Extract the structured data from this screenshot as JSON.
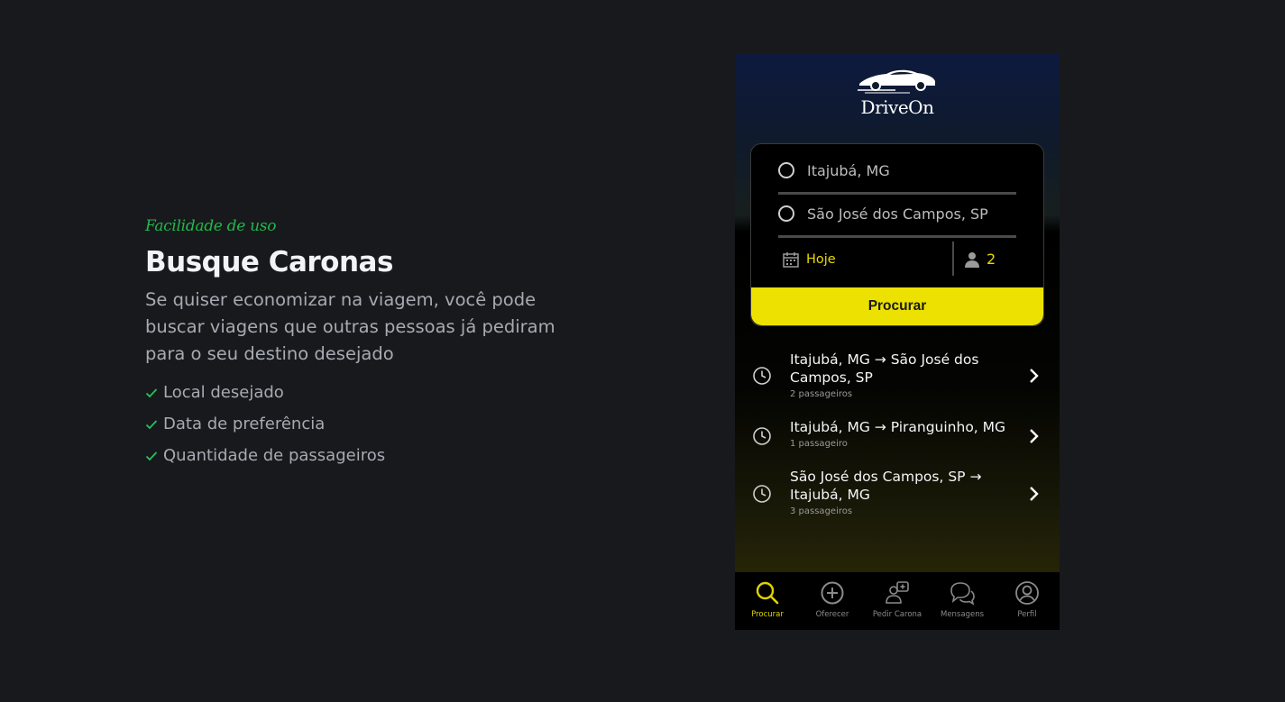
{
  "feature": {
    "eyebrow": "Facilidade de uso",
    "title": "Busque Caronas",
    "description": "Se quiser economizar na viagem, você pode buscar viagens que outras pessoas já pediram para o seu destino desejado",
    "checks": [
      "Local desejado",
      "Data de preferência",
      "Quantidade de passageiros"
    ]
  },
  "app": {
    "logo": "DriveOn",
    "search": {
      "origin": "Itajubá, MG",
      "destination": "São José dos Campos, SP",
      "date": "Hoje",
      "passengers": "2",
      "button": "Procurar"
    },
    "recent": [
      {
        "route": "Itajubá, MG → São José dos Campos, SP",
        "passengers": "2 passageiros"
      },
      {
        "route": "Itajubá, MG → Piranguinho, MG",
        "passengers": "1 passageiro"
      },
      {
        "route": "São José dos Campos, SP → Itajubá, MG",
        "passengers": "3 passageiros"
      }
    ],
    "tabs": [
      "Procurar",
      "Oferecer",
      "Pedir Carona",
      "Mensagens",
      "Perfil"
    ]
  },
  "colors": {
    "accent": "#ece100",
    "check": "#22c55e",
    "eyebrow": "#22b84c",
    "background": "#18191c"
  }
}
